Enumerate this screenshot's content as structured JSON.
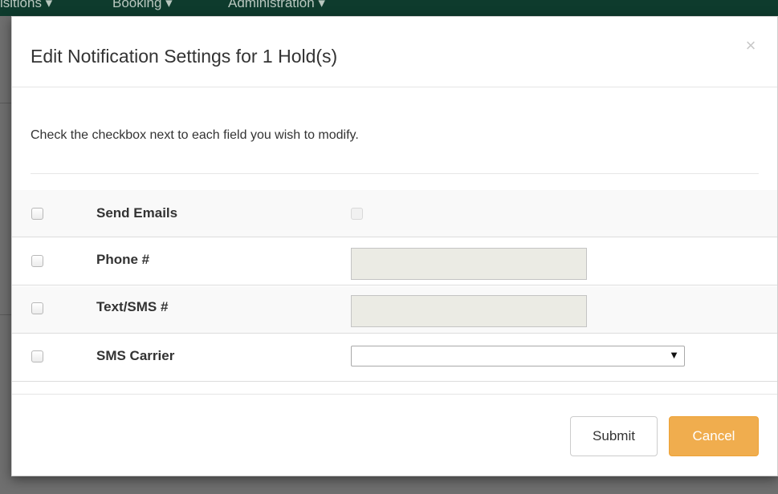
{
  "navbar": {
    "items": [
      {
        "label": "isitions ▾"
      },
      {
        "label": "Booking ▾"
      },
      {
        "label": "Administration ▾"
      }
    ]
  },
  "modal": {
    "title": "Edit Notification Settings for 1 Hold(s)",
    "close_label": "×",
    "instructions": "Check the checkbox next to each field you wish to modify.",
    "fields": [
      {
        "label": "Send Emails",
        "type": "checkbox",
        "enabled": false,
        "checked": false
      },
      {
        "label": "Phone #",
        "type": "text",
        "value": "",
        "enabled": false
      },
      {
        "label": "Text/SMS #",
        "type": "text",
        "value": "",
        "enabled": false
      },
      {
        "label": "SMS Carrier",
        "type": "select",
        "selected": ""
      }
    ],
    "submit_label": "Submit",
    "cancel_label": "Cancel"
  },
  "colors": {
    "navbar": "#0e3b2d",
    "cancel_button": "#f0ad4e",
    "overlay": "#666666"
  }
}
